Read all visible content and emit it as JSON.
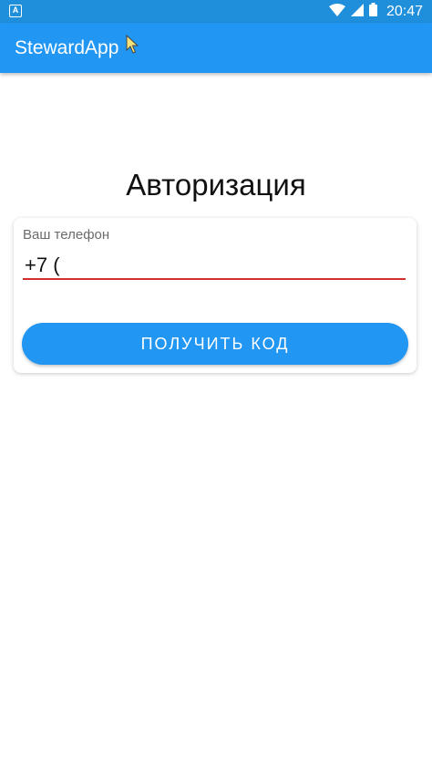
{
  "status_bar": {
    "time": "20:47",
    "notification_glyph": "A",
    "icons": [
      "notification-icon",
      "wifi-icon",
      "cellular-signal-icon",
      "battery-icon"
    ]
  },
  "app_bar": {
    "title": "StewardApp"
  },
  "main": {
    "title": "Авторизация",
    "phone_field": {
      "label": "Ваш телефон",
      "value": "+7 ("
    },
    "get_code_button": "ПОЛУЧИТЬ КОД"
  },
  "colors": {
    "status_bar": "#1f8fdc",
    "app_bar": "#2196f3",
    "button": "#2196f3",
    "input_underline_error": "#d32f2f",
    "background": "#ffffff"
  }
}
